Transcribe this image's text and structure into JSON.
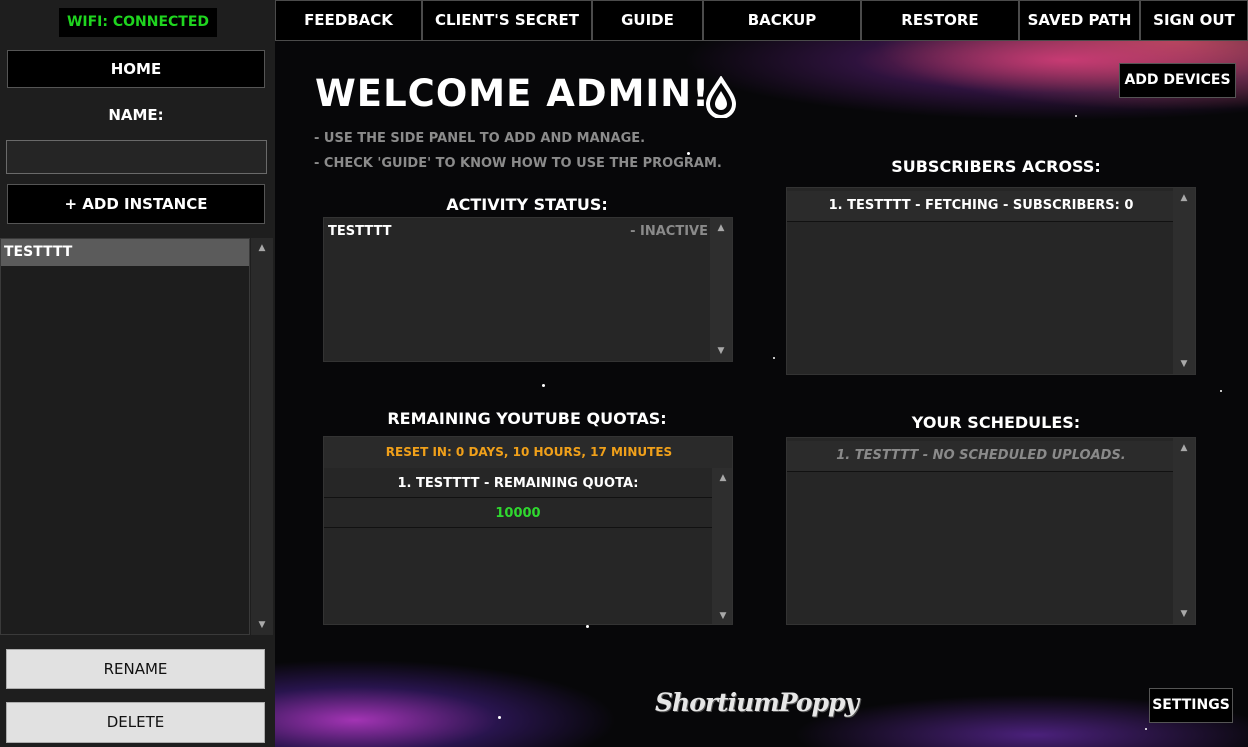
{
  "sidebar": {
    "wifi_status": "WIFI: CONNECTED",
    "home_label": "HOME",
    "name_label": "NAME:",
    "name_value": "",
    "add_instance_label": "+ ADD INSTANCE",
    "instances": [
      "TESTTTT"
    ],
    "rename_label": "RENAME",
    "delete_label": "DELETE"
  },
  "topbar": {
    "items": [
      "FEEDBACK",
      "CLIENT'S SECRET",
      "GUIDE",
      "BACKUP",
      "RESTORE",
      "SAVED PATH",
      "SIGN OUT"
    ]
  },
  "main": {
    "welcome": "WELCOME ADMIN!",
    "hint_1": "- USE THE SIDE PANEL TO ADD AND MANAGE.",
    "hint_2": "- CHECK 'GUIDE' TO KNOW HOW TO USE THE PROGRAM.",
    "add_devices_label": "ADD DEVICES",
    "activity": {
      "title": "ACTIVITY STATUS:",
      "rows": [
        {
          "name": "TESTTTT",
          "status": "- INACTIVE"
        }
      ]
    },
    "subscribers": {
      "title": "SUBSCRIBERS ACROSS:",
      "rows": [
        "1. TESTTTT - FETCHING - SUBSCRIBERS: 0"
      ]
    },
    "quotas": {
      "title": "REMAINING YOUTUBE QUOTAS:",
      "reset": "RESET IN: 0 DAYS, 10 HOURS, 17 MINUTES",
      "rows": [
        "1. TESTTTT - REMAINING QUOTA:"
      ],
      "values": [
        "10000"
      ]
    },
    "schedules": {
      "title": "YOUR SCHEDULES:",
      "rows": [
        "1. TESTTTT - NO SCHEDULED UPLOADS."
      ]
    },
    "brand": "ShortiumPoppy",
    "settings_label": "SETTINGS"
  },
  "colors": {
    "wifi_green": "#1fd51f",
    "quota_green": "#2fd82f",
    "reset_orange": "#f0a01a",
    "muted_text": "#8a8a8a"
  },
  "icons": [
    "water-drop-icon",
    "scroll-up-arrow-icon",
    "scroll-down-arrow-icon"
  ]
}
